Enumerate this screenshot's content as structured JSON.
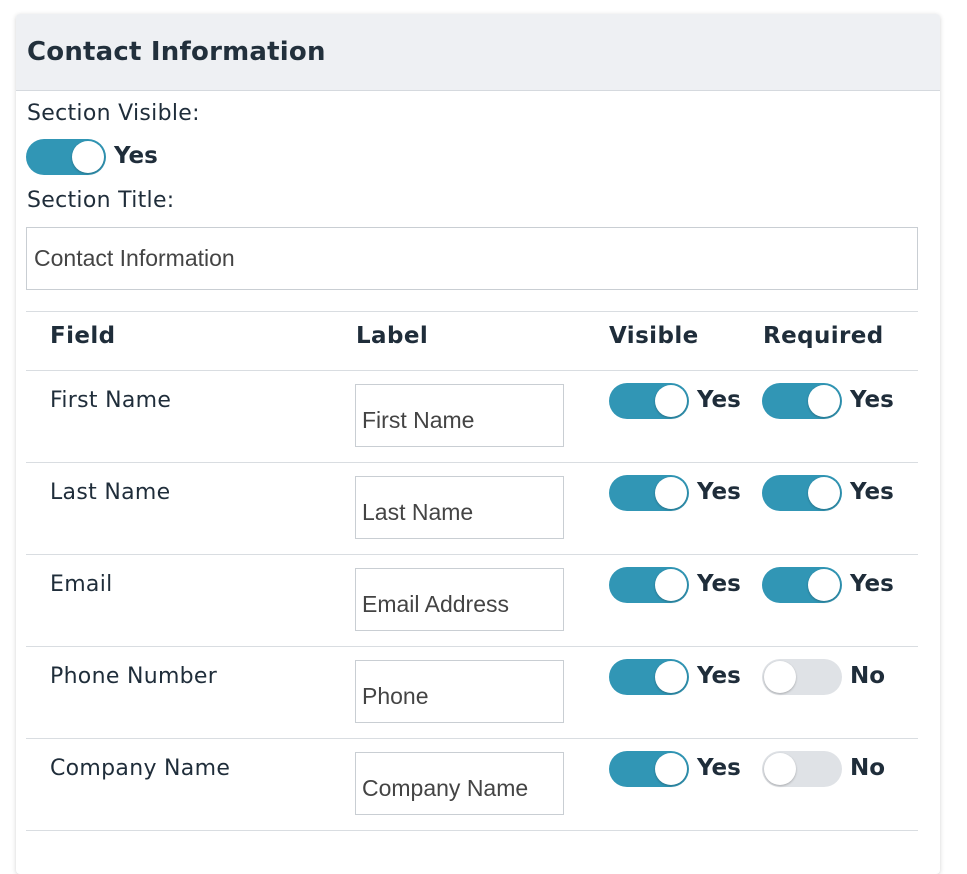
{
  "section": {
    "title": "Contact Information",
    "visible_label": "Section Visible:",
    "visible_state": "Yes",
    "title_label": "Section Title:",
    "title_value": "Contact Information"
  },
  "table": {
    "headers": [
      "Field",
      "Label",
      "Visible",
      "Required"
    ],
    "rows": [
      {
        "field": "First Name",
        "label": "First Name",
        "visible": "Yes",
        "visible_on": true,
        "required": "Yes",
        "required_on": true
      },
      {
        "field": "Last Name",
        "label": "Last Name",
        "visible": "Yes",
        "visible_on": true,
        "required": "Yes",
        "required_on": true
      },
      {
        "field": "Email",
        "label": "Email Address",
        "visible": "Yes",
        "visible_on": true,
        "required": "Yes",
        "required_on": true
      },
      {
        "field": "Phone Number",
        "label": "Phone",
        "visible": "Yes",
        "visible_on": true,
        "required": "No",
        "required_on": false
      },
      {
        "field": "Company Name",
        "label": "Company Name",
        "visible": "Yes",
        "visible_on": true,
        "required": "No",
        "required_on": false
      }
    ]
  },
  "colors": {
    "toggle_on": "#3196b5",
    "toggle_off": "#dfe2e6",
    "header_bg": "#eef0f3"
  }
}
